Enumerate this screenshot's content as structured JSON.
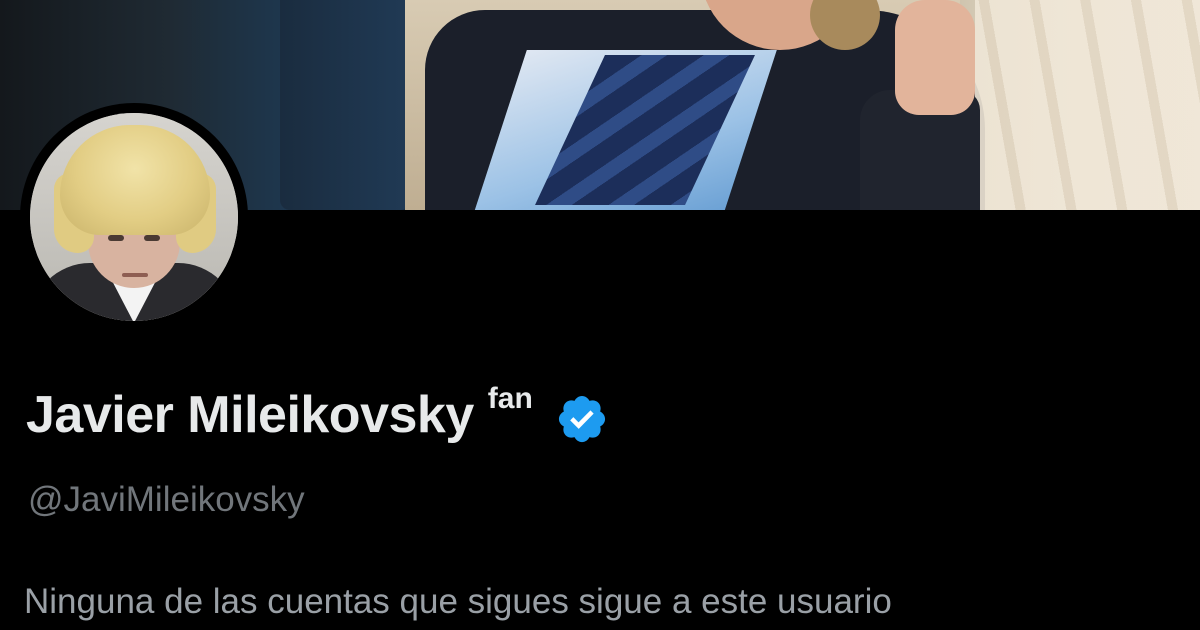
{
  "profile": {
    "display_name": "Javier Mileikovsky",
    "name_suffix": "fan",
    "handle": "@JaviMileikovsky",
    "followers_you_know": "Ninguna de las cuentas que sigues sigue a este usuario",
    "verified_icon": "verified-badge-icon",
    "accent_color": "#1d9bf0"
  },
  "theme": {
    "background": "#000000",
    "primary_text": "#e7e9ea",
    "secondary_text": "#71767b"
  }
}
